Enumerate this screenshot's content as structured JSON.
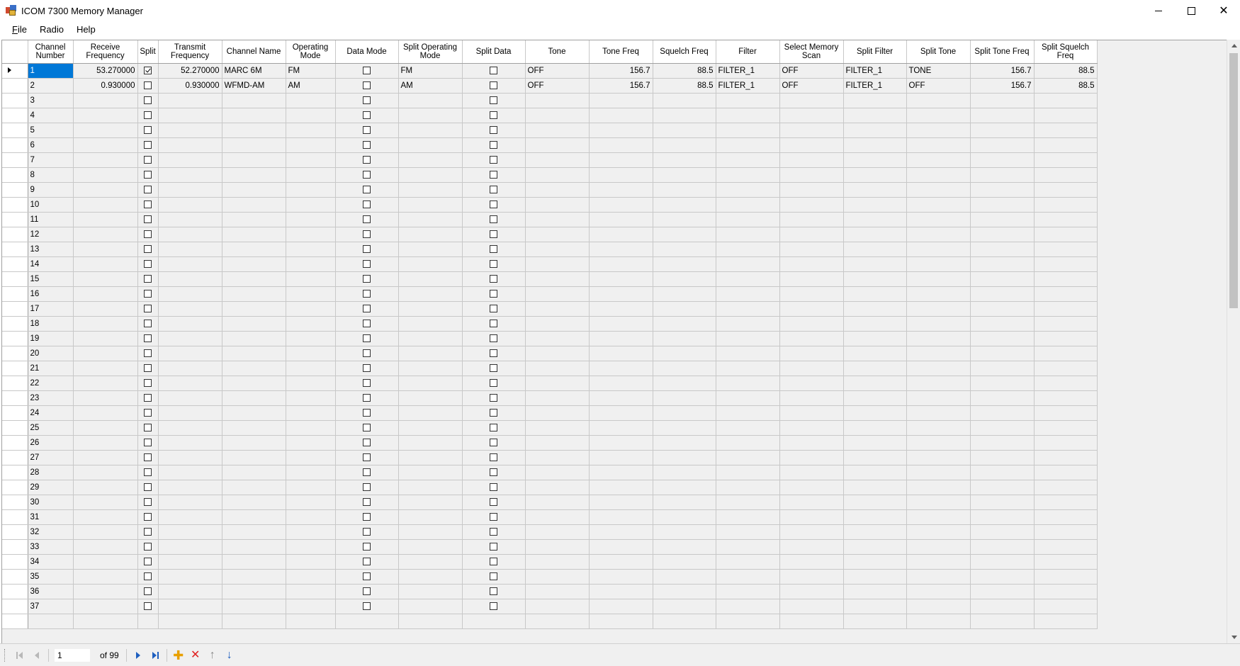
{
  "window": {
    "title": "ICOM 7300 Memory Manager"
  },
  "menu": [
    {
      "label": "File",
      "accel": "F",
      "rest": "ile"
    },
    {
      "label": "Radio"
    },
    {
      "label": "Help"
    }
  ],
  "grid": {
    "columns": [
      {
        "key": "channel",
        "label": "Channel Number",
        "type": "text"
      },
      {
        "key": "rx",
        "label": "Receive Frequency",
        "type": "num"
      },
      {
        "key": "split",
        "label": "Split",
        "type": "check"
      },
      {
        "key": "tx",
        "label": "Transmit Frequency",
        "type": "num"
      },
      {
        "key": "name",
        "label": "Channel Name",
        "type": "text"
      },
      {
        "key": "mode",
        "label": "Operating Mode",
        "type": "text"
      },
      {
        "key": "data_mode",
        "label": "Data Mode",
        "type": "check"
      },
      {
        "key": "split_mode",
        "label": "Split Operating Mode",
        "type": "text"
      },
      {
        "key": "split_data",
        "label": "Split Data",
        "type": "check"
      },
      {
        "key": "tone",
        "label": "Tone",
        "type": "text"
      },
      {
        "key": "tone_freq",
        "label": "Tone Freq",
        "type": "num"
      },
      {
        "key": "squelch_freq",
        "label": "Squelch Freq",
        "type": "num"
      },
      {
        "key": "filter",
        "label": "Filter",
        "type": "text"
      },
      {
        "key": "scan",
        "label": "Select Memory Scan",
        "type": "text"
      },
      {
        "key": "split_filter",
        "label": "Split Filter",
        "type": "text"
      },
      {
        "key": "split_tone",
        "label": "Split Tone",
        "type": "text"
      },
      {
        "key": "split_tone_freq",
        "label": "Split Tone Freq",
        "type": "num"
      },
      {
        "key": "split_squelch_freq",
        "label": "Split Squelch Freq",
        "type": "num"
      }
    ],
    "rows": [
      {
        "channel": "1",
        "rx": "53.270000",
        "split": true,
        "tx": "52.270000",
        "name": "MARC 6M",
        "mode": "FM",
        "data_mode": false,
        "split_mode": "FM",
        "split_data": false,
        "tone": "OFF",
        "tone_freq": "156.7",
        "squelch_freq": "88.5",
        "filter": "FILTER_1",
        "scan": "OFF",
        "split_filter": "FILTER_1",
        "split_tone": "TONE",
        "split_tone_freq": "156.7",
        "split_squelch_freq": "88.5"
      },
      {
        "channel": "2",
        "rx": "0.930000",
        "split": false,
        "tx": "0.930000",
        "name": "WFMD-AM",
        "mode": "AM",
        "data_mode": false,
        "split_mode": "AM",
        "split_data": false,
        "tone": "OFF",
        "tone_freq": "156.7",
        "squelch_freq": "88.5",
        "filter": "FILTER_1",
        "scan": "OFF",
        "split_filter": "FILTER_1",
        "split_tone": "OFF",
        "split_tone_freq": "156.7",
        "split_squelch_freq": "88.5"
      },
      {
        "channel": "3"
      },
      {
        "channel": "4"
      },
      {
        "channel": "5"
      },
      {
        "channel": "6"
      },
      {
        "channel": "7"
      },
      {
        "channel": "8"
      },
      {
        "channel": "9"
      },
      {
        "channel": "10"
      },
      {
        "channel": "11"
      },
      {
        "channel": "12"
      },
      {
        "channel": "13"
      },
      {
        "channel": "14"
      },
      {
        "channel": "15"
      },
      {
        "channel": "16"
      },
      {
        "channel": "17"
      },
      {
        "channel": "18"
      },
      {
        "channel": "19"
      },
      {
        "channel": "20"
      },
      {
        "channel": "21"
      },
      {
        "channel": "22"
      },
      {
        "channel": "23"
      },
      {
        "channel": "24"
      },
      {
        "channel": "25"
      },
      {
        "channel": "26"
      },
      {
        "channel": "27"
      },
      {
        "channel": "28"
      },
      {
        "channel": "29"
      },
      {
        "channel": "30"
      },
      {
        "channel": "31"
      },
      {
        "channel": "32"
      },
      {
        "channel": "33"
      },
      {
        "channel": "34"
      },
      {
        "channel": "35"
      },
      {
        "channel": "36"
      },
      {
        "channel": "37"
      },
      {
        "channel": ""
      }
    ],
    "current_row": 0
  },
  "navigator": {
    "position": "1",
    "count_label": "of 99"
  },
  "colors": {
    "selection": "#0078d7",
    "grid_background": "#f0f0f0"
  }
}
